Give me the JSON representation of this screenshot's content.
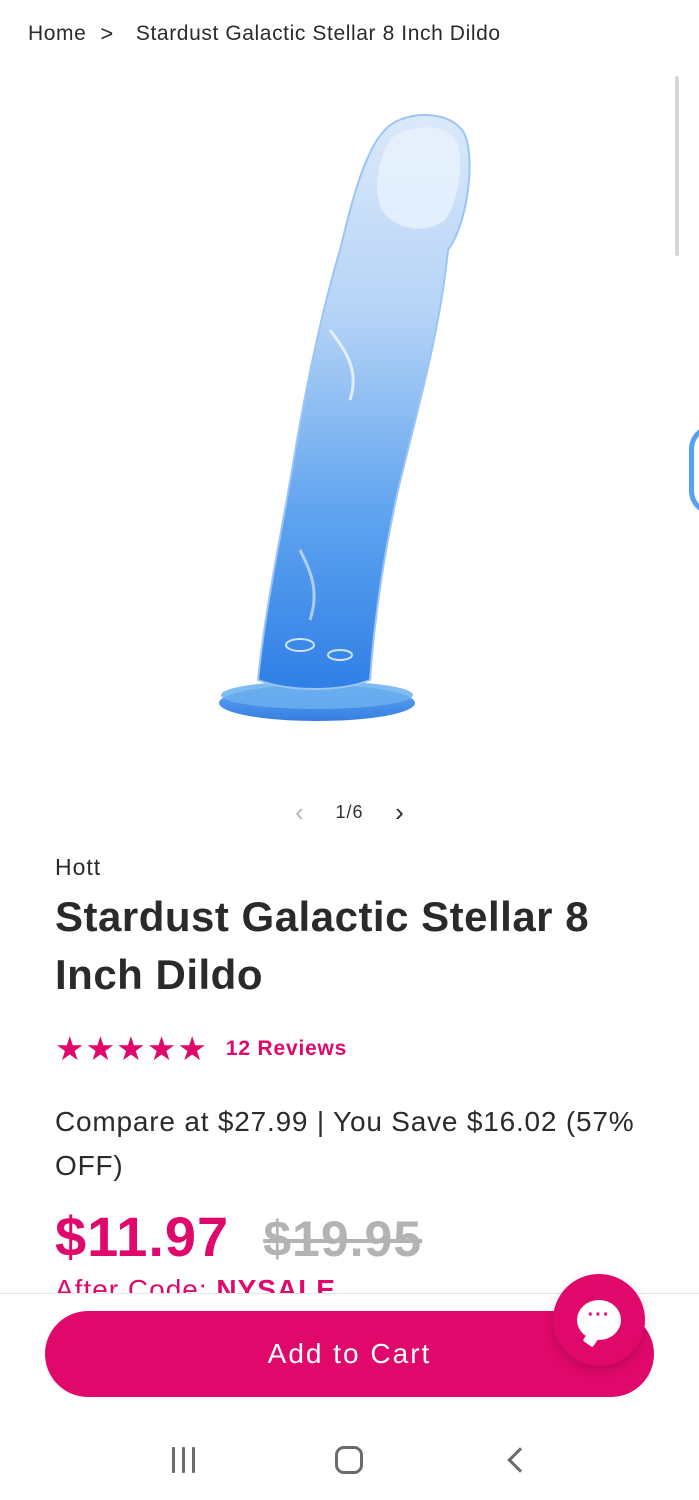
{
  "breadcrumb": {
    "home": "Home",
    "separator": ">",
    "current": "Stardust Galactic Stellar 8 Inch Dildo"
  },
  "gallery": {
    "counter": "1/6",
    "prev_icon": "chevron-left-icon",
    "next_icon": "chevron-right-icon",
    "prev_glyph": "‹",
    "next_glyph": "›"
  },
  "product": {
    "vendor": "Hott",
    "title": "Stardust Galactic Stellar 8 Inch Dildo",
    "stars_glyph": "★★★★★",
    "rating": 5,
    "rating_max": 5,
    "reviews_label": "12 Reviews",
    "compare_text": "Compare at $27.99 | You Save $16.02 (57% OFF)",
    "sale_price": "$11.97",
    "original_price": "$19.95",
    "after_code_label": "After Code: ",
    "discount_code": "NYSALE"
  },
  "actions": {
    "add_to_cart": "Add to Cart",
    "chat_dots": "···",
    "chat_icon": "chat-bubble-icon"
  },
  "colors": {
    "accent": "#e0096b",
    "text": "#2b2b2b",
    "strike": "#b3b3b3",
    "product_blue": "#3d8be8"
  }
}
